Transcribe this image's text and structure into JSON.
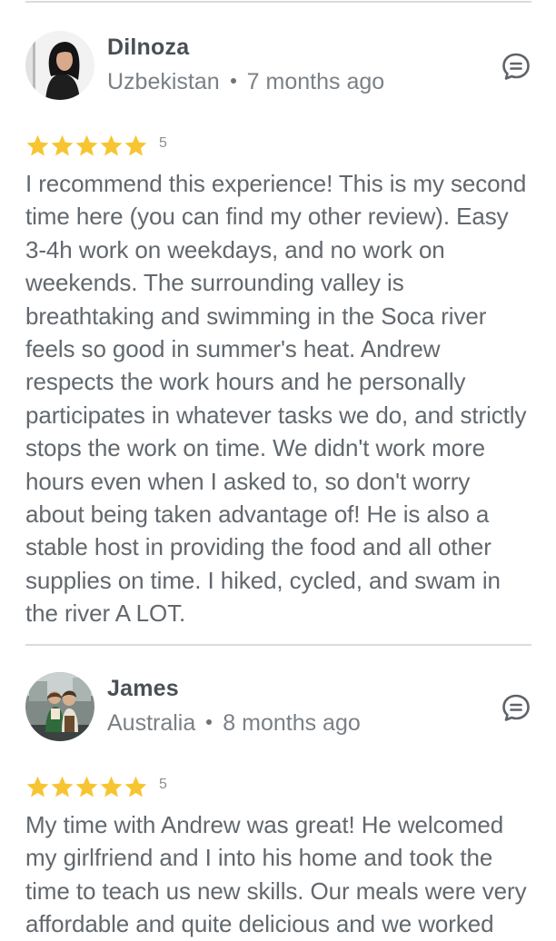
{
  "reviews": [
    {
      "name": "Dilnoza",
      "country": "Uzbekistan",
      "time_ago": "7 months ago",
      "rating": 5,
      "rating_label": "5",
      "text": "I recommend this experience! This is my second time here (you can find my other review). Easy 3-4h work on weekdays, and no work on weekends. The surrounding valley is breathtaking and swimming in the Soca river feels so good in summer's heat. Andrew respects the work hours and he personally participates in whatever tasks we do, and strictly stops the work on time. We didn't work more hours even when I asked to, so don't worry about being taken advantage of! He is also a stable host in providing the food and all other supplies on time. I hiked, cycled, and swam in the river A LOT."
    },
    {
      "name": "James",
      "country": "Australia",
      "time_ago": "8 months ago",
      "rating": 5,
      "rating_label": "5",
      "text": "My time with Andrew was great! He welcomed my girlfriend and I into his home and took the time to teach us new skills. Our meals were very affordable and quite delicious and we worked"
    }
  ],
  "icons": {
    "comment": "comment-bubble-icon",
    "star": "star-icon"
  },
  "colors": {
    "star": "#f7c531",
    "divider": "#d9dcdf",
    "text": "#62686d",
    "name": "#4a4f54"
  }
}
